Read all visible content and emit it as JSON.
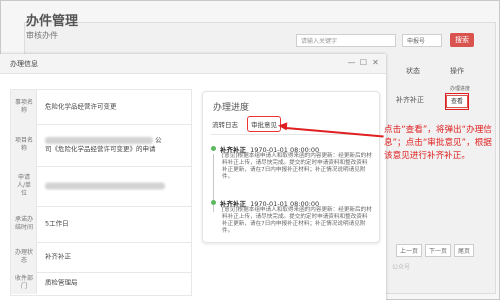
{
  "background": {
    "title": "办件管理",
    "subtitle": "审核办件",
    "search_placeholder": "请输入关键字",
    "select_value": "申报号",
    "search_button": "搜索",
    "col_state": "状态",
    "col_action": "操作",
    "row_state": "补齐补正",
    "row_link_top": "办理进度",
    "view_button": "查看",
    "pager_prev": "上一页",
    "pager_next": "下一页",
    "pager_last": "尾页",
    "bottom_note": "公众号"
  },
  "modal": {
    "title": "办理信息",
    "controls": {
      "minimize": "—",
      "maximize": "☐",
      "close": "✕"
    },
    "fields": [
      {
        "label": "事项名称",
        "value": "危险化学品经营许可变更"
      },
      {
        "label": "项目名称",
        "value_suffix_top": "公",
        "value_bottom": "司《危险化学品经营许可变更》的申请"
      },
      {
        "label": "申请人/单位",
        "value": ""
      },
      {
        "label": "承诺办结时间",
        "value": "5工作日"
      },
      {
        "label": "办理状态",
        "value": "补齐补正"
      },
      {
        "label": "收件部门",
        "value": "质检管理局"
      }
    ],
    "progress": {
      "title": "办理进度",
      "tabs": [
        {
          "label": "流转日志"
        },
        {
          "label": "审批意见"
        }
      ],
      "entries": [
        {
          "status": "补齐补正",
          "time": "1970-01-01 08:00:00",
          "body": "[意见]根据本组申请人和取得来函的内容更新：经更新后的材料补正上传，请尽快完成。提交的定时申请资料和整改资料补正更新，请在7日内申报补正材料；补正情况说明请见附件。"
        },
        {
          "status": "补齐补正",
          "time": "1970-01-01 08:00:00",
          "body": "[意见]根据本组申请人和取得来函的内容更新：经更新后的材料补正上传，请尽快完成。提交的定时申请资料和整改资料补正更新，请在7日内申报补正材料；补正情况说明请见附件。"
        }
      ]
    }
  },
  "annotation": {
    "text": "点击“查看”，将弹出“办理信息”；点击“审批意见”，根据该意见进行补齐补正。"
  },
  "colors": {
    "accent_red": "#e02020",
    "search_button": "#d9534f",
    "timeline_dot": "#5cb85c"
  }
}
